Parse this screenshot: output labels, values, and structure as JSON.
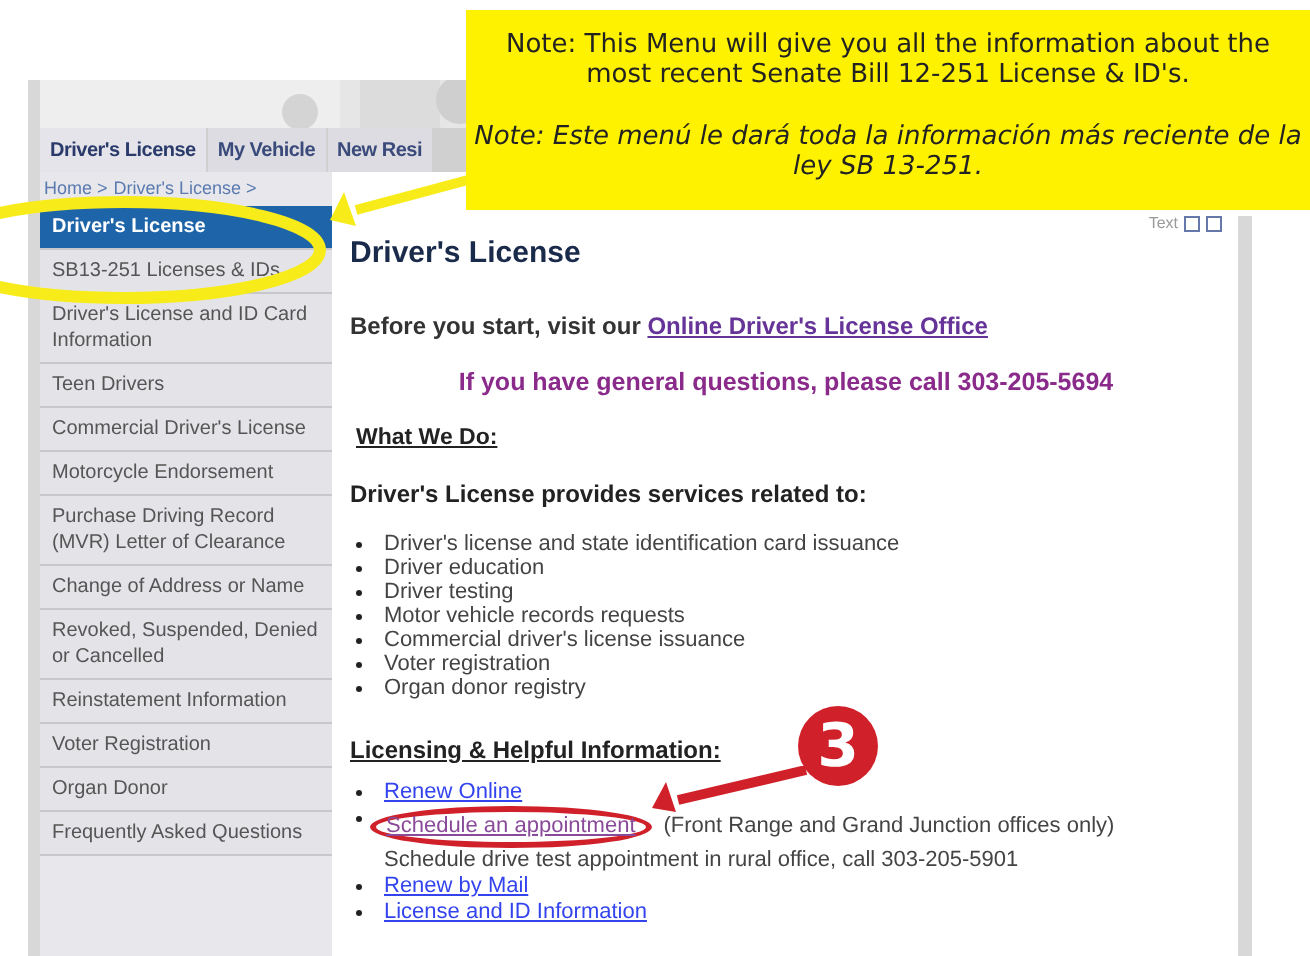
{
  "nav_tabs": [
    {
      "label": "Driver's License",
      "selected": true
    },
    {
      "label": "My Vehicle",
      "selected": false
    },
    {
      "label": "New Resi",
      "selected": false
    }
  ],
  "breadcrumb": [
    "Home >",
    "Driver's License >"
  ],
  "sidebar": {
    "items": [
      {
        "label": "Driver's License",
        "selected": true
      },
      {
        "label": "SB13-251 Licenses & IDs",
        "selected": false
      },
      {
        "label": "Driver's License and ID Card Information",
        "selected": false
      },
      {
        "label": "Teen Drivers",
        "selected": false
      },
      {
        "label": "Commercial Driver's License",
        "selected": false
      },
      {
        "label": "Motorcycle Endorsement",
        "selected": false
      },
      {
        "label": "Purchase Driving Record (MVR) Letter of Clearance",
        "selected": false
      },
      {
        "label": "Change of Address or Name",
        "selected": false
      },
      {
        "label": "Revoked, Suspended, Denied or Cancelled",
        "selected": false
      },
      {
        "label": "Reinstatement Information",
        "selected": false
      },
      {
        "label": "Voter Registration",
        "selected": false
      },
      {
        "label": "Organ Donor",
        "selected": false
      },
      {
        "label": "Frequently Asked Questions",
        "selected": false
      }
    ]
  },
  "content": {
    "text_size_label": "Text",
    "title": "Driver's License",
    "intro": "Before you start, visit our",
    "intro_link": "Online Driver's License Office",
    "phone_line": "If you have general questions, please call 303-205-5694",
    "what_we_do": "What We Do:",
    "services_heading": "Driver's License provides services related to:",
    "services": [
      "Driver's license and state identification card issuance",
      "Driver education",
      "Driver testing",
      "Motor vehicle records requests",
      "Commercial driver's license issuance",
      "Voter registration",
      "Organ donor registry"
    ],
    "links_heading": "Licensing & Helpful Information:",
    "links": [
      {
        "label": "Renew Online",
        "visited": false,
        "circled": false
      },
      {
        "label": "Schedule an appointment",
        "visited": true,
        "circled": true,
        "note": "(Front Range and Grand Junction offices only)",
        "extra": "Schedule drive test appointment in rural office, call 303-205-5901"
      },
      {
        "label": "Renew by Mail",
        "visited": false,
        "circled": false
      },
      {
        "label": "License and ID Information",
        "visited": false,
        "circled": false
      }
    ]
  },
  "annotations": {
    "note_english": "Note: This Menu will give you all the information about the most recent Senate Bill 12-251 License & ID's.",
    "note_spanish": "Note: Este menú le dará toda la información más reciente de la ley SB 13-251.",
    "step_number": "3"
  }
}
